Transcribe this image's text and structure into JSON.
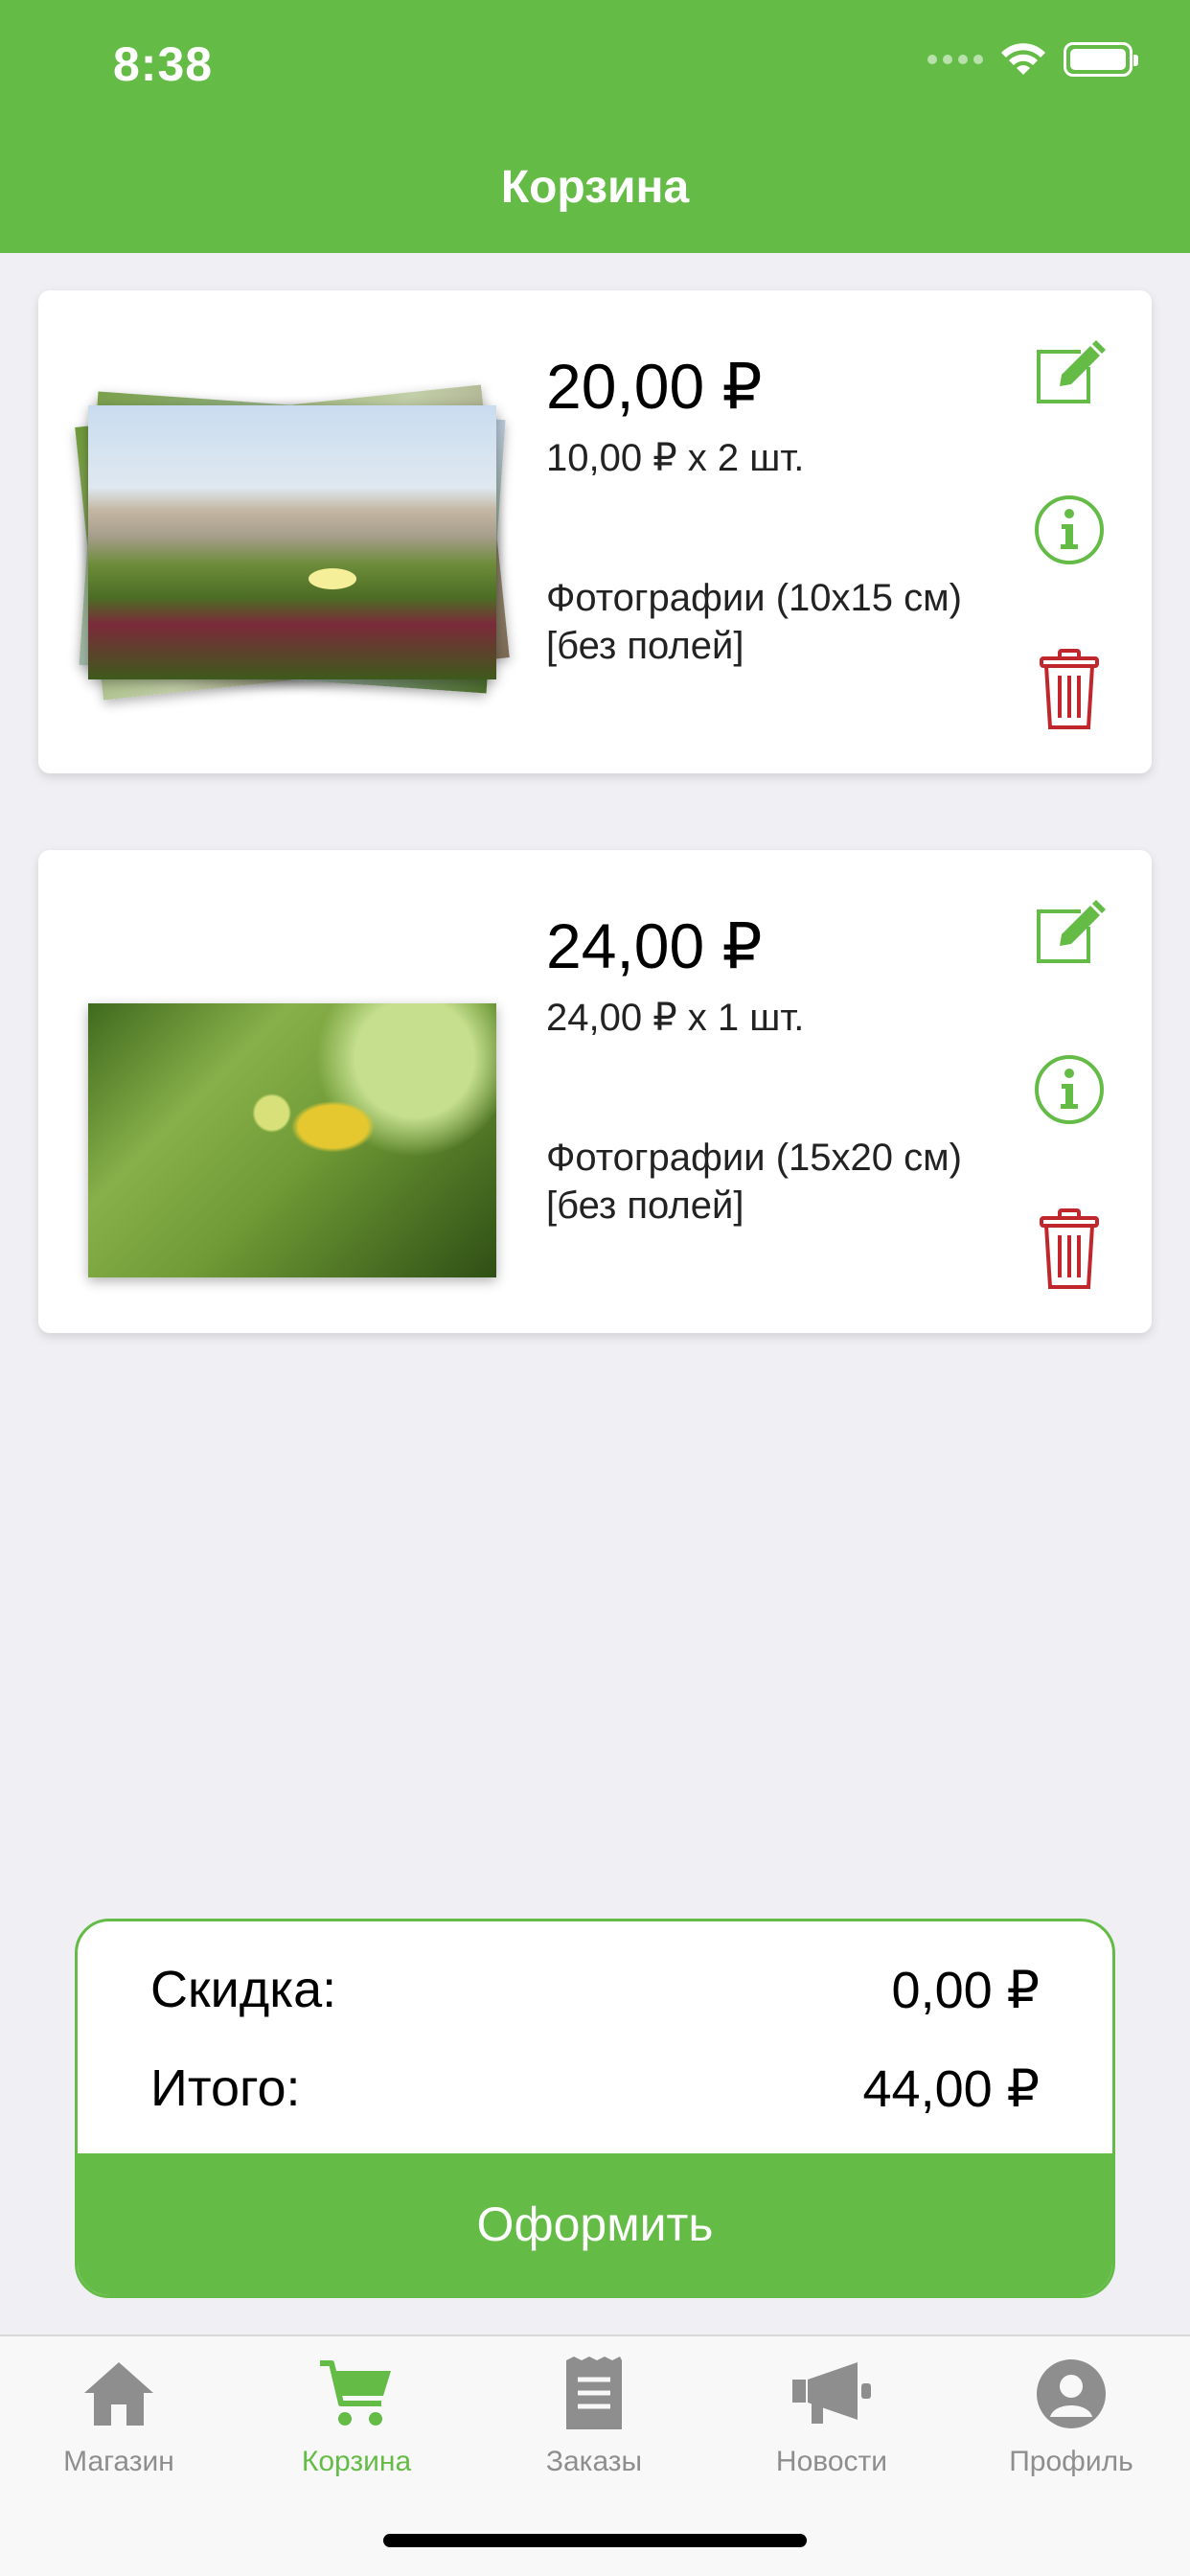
{
  "status_bar": {
    "time": "8:38"
  },
  "header": {
    "title": "Корзина"
  },
  "cart_items": [
    {
      "price": "20,00 ₽",
      "unit_price": "10,00 ₽ x 2 шт.",
      "product_line1": "Фотографии (10x15 см)",
      "product_line2": "[без полей]",
      "thumbnail": "stack-of-photos-beach-plants"
    },
    {
      "price": "24,00 ₽",
      "unit_price": "24,00 ₽ x 1 шт.",
      "product_line1": "Фотографии (15x20 см)",
      "product_line2": "[без полей]",
      "thumbnail": "photo-green-leaves"
    }
  ],
  "item_actions": {
    "edit_icon": "edit-icon",
    "info_icon": "info-icon",
    "delete_icon": "trash-icon"
  },
  "summary": {
    "discount_label": "Скидка:",
    "discount_value": "0,00 ₽",
    "total_label": "Итого:",
    "total_value": "44,00 ₽",
    "checkout_label": "Оформить"
  },
  "tabs": [
    {
      "label": "Магазин",
      "icon": "home-icon",
      "active": false
    },
    {
      "label": "Корзина",
      "icon": "cart-icon",
      "active": true
    },
    {
      "label": "Заказы",
      "icon": "receipt-icon",
      "active": false
    },
    {
      "label": "Новости",
      "icon": "megaphone-icon",
      "active": false
    },
    {
      "label": "Профиль",
      "icon": "profile-icon",
      "active": false
    }
  ],
  "colors": {
    "brand_green": "#64bc47",
    "delete_red": "#c0272d",
    "tab_inactive": "#8e8e8e"
  }
}
